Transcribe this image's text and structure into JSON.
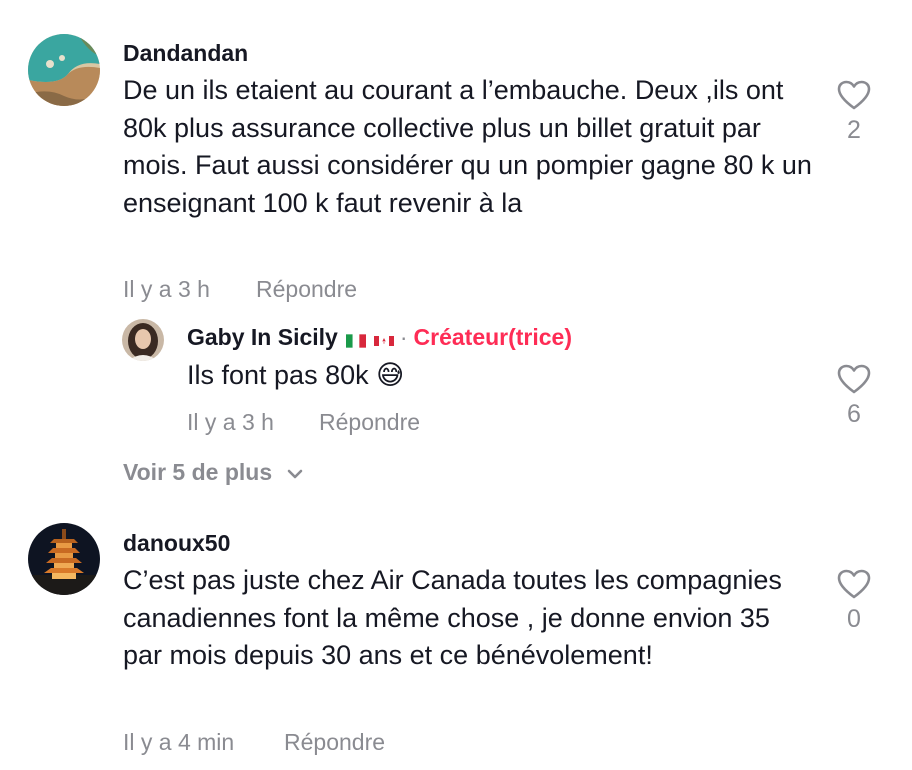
{
  "comments": [
    {
      "username": "Dandandan",
      "text": "De un ils etaient au courant a l’embauche. Deux ,ils ont 80k plus assurance collective plus un billet gratuit par mois. Faut aussi considérer qu un pompier gagne 80 k un enseignant 100 k faut revenir à la",
      "timestamp": "Il y a 3 h",
      "reply_label": "Répondre",
      "likes": "2",
      "avatar_icon": "beach-photo",
      "reply": {
        "username": "Gaby In Sicily",
        "flags": [
          "italy-flag-icon",
          "canada-flag-icon"
        ],
        "separator": "·",
        "badge": "Créateur(trice)",
        "text": "Ils font pas 80k",
        "emoji": "😅",
        "timestamp": "Il y a 3 h",
        "reply_label": "Répondre",
        "likes": "6",
        "avatar_icon": "woman-portrait"
      },
      "view_more_label": "Voir 5 de plus"
    },
    {
      "username": "danoux50",
      "text": "C’est pas juste chez Air Canada toutes les compagnies canadiennes font la même chose , je donne envion 35 par mois depuis 30 ans et ce bénévolement!",
      "timestamp": "Il y a 4 min",
      "reply_label": "Répondre",
      "likes": "0",
      "avatar_icon": "pagoda-night-photo"
    }
  ],
  "colors": {
    "text": "#161823",
    "muted": "#8a8b91",
    "creator_accent": "#fe2c55"
  }
}
